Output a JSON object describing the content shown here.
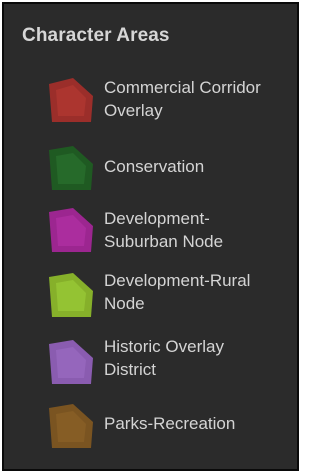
{
  "panel": {
    "title": "Character Areas"
  },
  "legend": {
    "items": [
      {
        "id": "commercial",
        "line1": "Commercial Corridor",
        "line2": "Overlay",
        "color": "#9b2e2a",
        "inner": "#b73a33"
      },
      {
        "id": "conservation",
        "line1": "Conservation",
        "line2": "",
        "color": "#1f5a22",
        "inner": "#2c7430"
      },
      {
        "id": "suburban",
        "line1": "Development-",
        "line2": "Suburban Node",
        "color": "#9c2690",
        "inner": "#b532a8"
      },
      {
        "id": "rural",
        "line1": "Development-Rural",
        "line2": "Node",
        "color": "#86b02a",
        "inner": "#9fd13a"
      },
      {
        "id": "historic",
        "line1": "Historic Overlay",
        "line2": "District",
        "color": "#8a5cb0",
        "inner": "#9d6dc4"
      },
      {
        "id": "parks",
        "line1": "Parks-Recreation",
        "line2": "",
        "color": "#7a5421",
        "inner": "#8e6428"
      }
    ]
  }
}
